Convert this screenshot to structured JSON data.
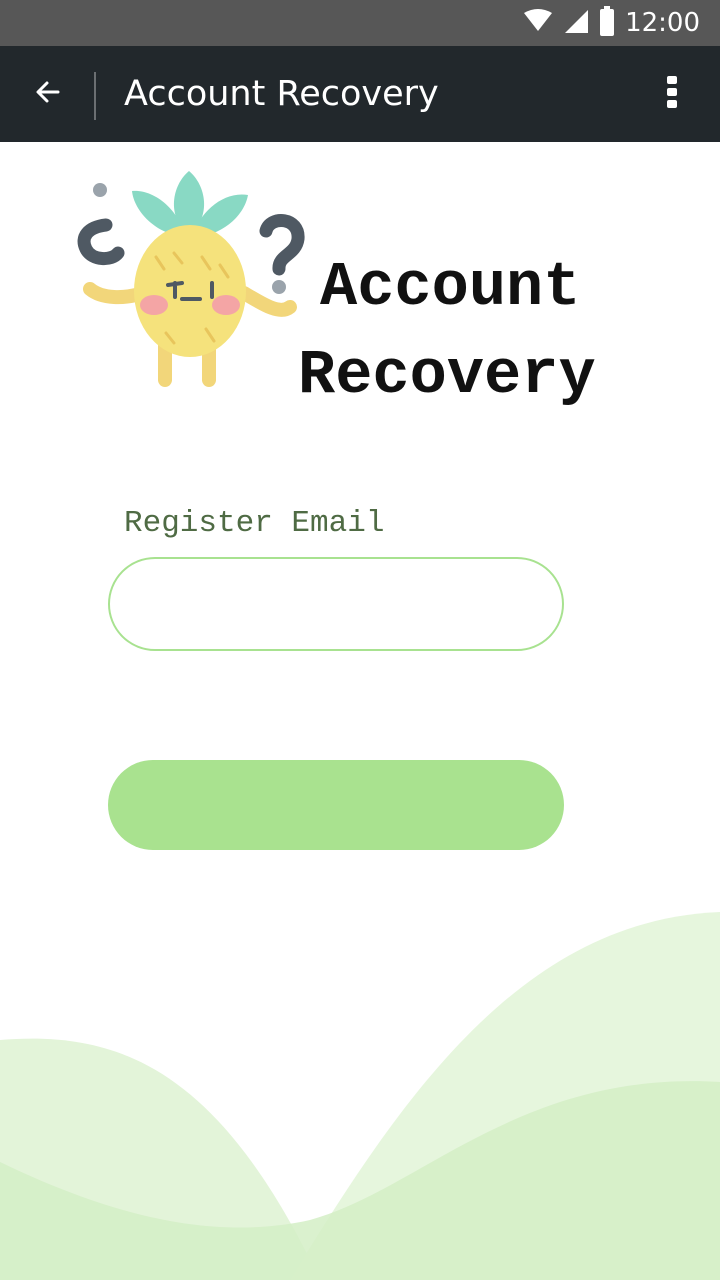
{
  "status_bar": {
    "time": "12:00",
    "icons": [
      "wifi-icon",
      "signal-icon",
      "battery-icon"
    ]
  },
  "app_bar": {
    "title": "Account Recovery",
    "back_icon": "arrow-left-icon",
    "menu_icon": "more-vertical-icon"
  },
  "logo": {
    "text_line1": "Account",
    "text_line2": "Recovery",
    "image": "confused-pineapple-illustration"
  },
  "form": {
    "email_label": "Register Email",
    "email_value": "",
    "submit_label": ""
  },
  "colors": {
    "status_bar": "#575757",
    "app_bar": "#22282c",
    "accent_green": "#a9e28f",
    "input_border": "#a8e290",
    "label_text": "#4f6b44",
    "wave_light": "#e3f4d9",
    "wave_mid": "#d3eec5"
  }
}
